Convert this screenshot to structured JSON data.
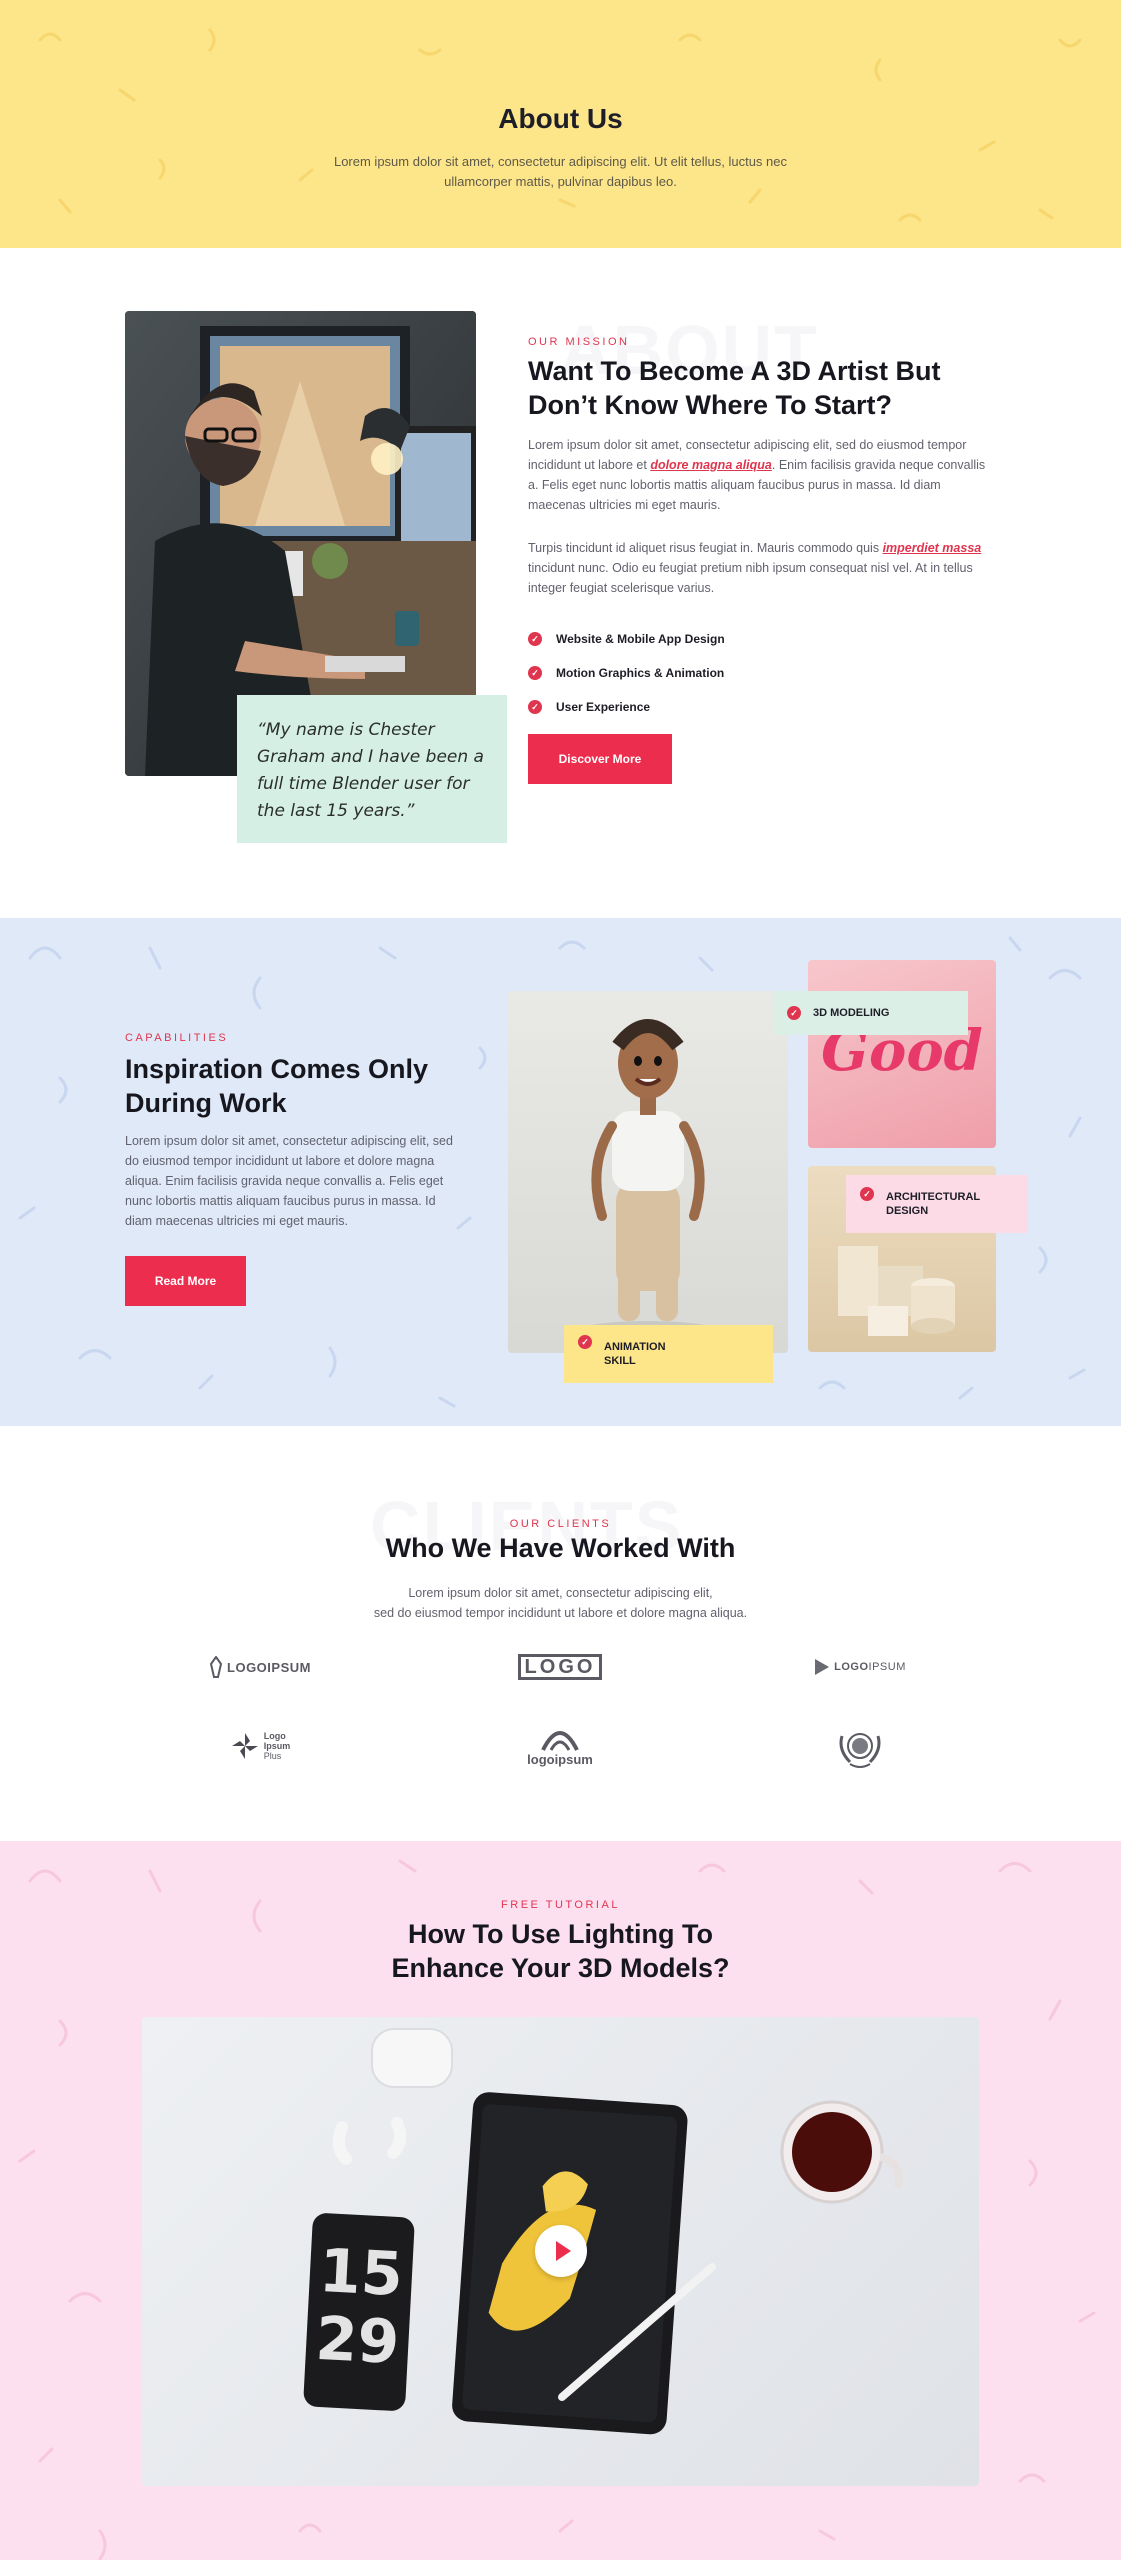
{
  "hero": {
    "title": "About Us",
    "text": "Lorem ipsum dolor sit amet, consectetur adipiscing elit. Ut elit tellus, luctus nec ullamcorper mattis, pulvinar dapibus leo."
  },
  "mission": {
    "bg_word": "ABOUT",
    "eyebrow": "OUR MISSION",
    "title": "Want To Become A 3D Artist But Don’t Know Where To Start?",
    "p1_start": "Lorem ipsum dolor sit amet, consectetur adipiscing elit, sed do eiusmod tempor incididunt ut labore et ",
    "p1_link": "dolore magna aliqua",
    "p1_end": ". Enim facilisis gravida neque convallis a. Felis eget nunc lobortis mattis aliquam faucibus purus in massa. Id diam maecenas ultricies mi eget mauris.",
    "p2_start": "Turpis tincidunt id aliquet risus feugiat in. Mauris commodo quis ",
    "p2_link": "imperdiet massa",
    "p2_end": " tincidunt nunc. Odio eu feugiat pretium nibh ipsum consequat nisl vel. At in tellus integer feugiat scelerisque varius.",
    "checklist": [
      "Website & Mobile App Design",
      "Motion Graphics & Animation",
      "User Experience"
    ],
    "button": "Discover More",
    "quote": "“My name is Chester Graham and I have been a full time Blender user for the last 15 years.”"
  },
  "capabilities": {
    "eyebrow": "CAPABILITIES",
    "title": "Inspiration Comes Only During Work",
    "text": "Lorem ipsum dolor sit amet, consectetur adipiscing elit, sed do eiusmod tempor incididunt ut labore et dolore magna aliqua. Enim facilisis gravida neque convallis a. Felis eget nunc lobortis mattis aliquam faucibus purus in massa. Id diam maecenas ultricies mi eget mauris.",
    "button": "Read More",
    "tags": [
      "3D MODELING",
      "ARCHITECTURAL DESIGN",
      "ANIMATION SKILL"
    ],
    "tag_lines": {
      "arch": [
        "ARCHITECTURAL",
        "DESIGN"
      ],
      "anim": [
        "ANIMATION",
        "SKILL"
      ]
    },
    "sculpture_text": "Good"
  },
  "clients": {
    "bg_word": "CLIENTS",
    "eyebrow": "OUR CLIENTS",
    "title": "Who We Have Worked With",
    "text_line1": "Lorem ipsum dolor sit amet, consectetur adipiscing elit,",
    "text_line2": "sed do eiusmod tempor incididunt ut labore et dolore magna aliqua.",
    "logos": {
      "l1": "LOGOIPSUM",
      "l2": "LOGO",
      "l3_a": "LOGO",
      "l3_b": "IPSUM",
      "l4": [
        "Logo",
        "Ipsum",
        "Plus"
      ],
      "l5": "logoipsum"
    }
  },
  "tutorial": {
    "eyebrow": "FREE TUTORIAL",
    "title_line1": "How To Use Lighting To",
    "title_line2": "Enhance Your 3D Models?",
    "clock": [
      "15",
      "29"
    ]
  },
  "colors": {
    "accent": "#ed2d4e",
    "hero_bg": "#fde58a",
    "capabilities_bg": "#dfe9f8",
    "tutorial_bg": "#fde0ef",
    "quote_bg": "#d6efe5"
  }
}
